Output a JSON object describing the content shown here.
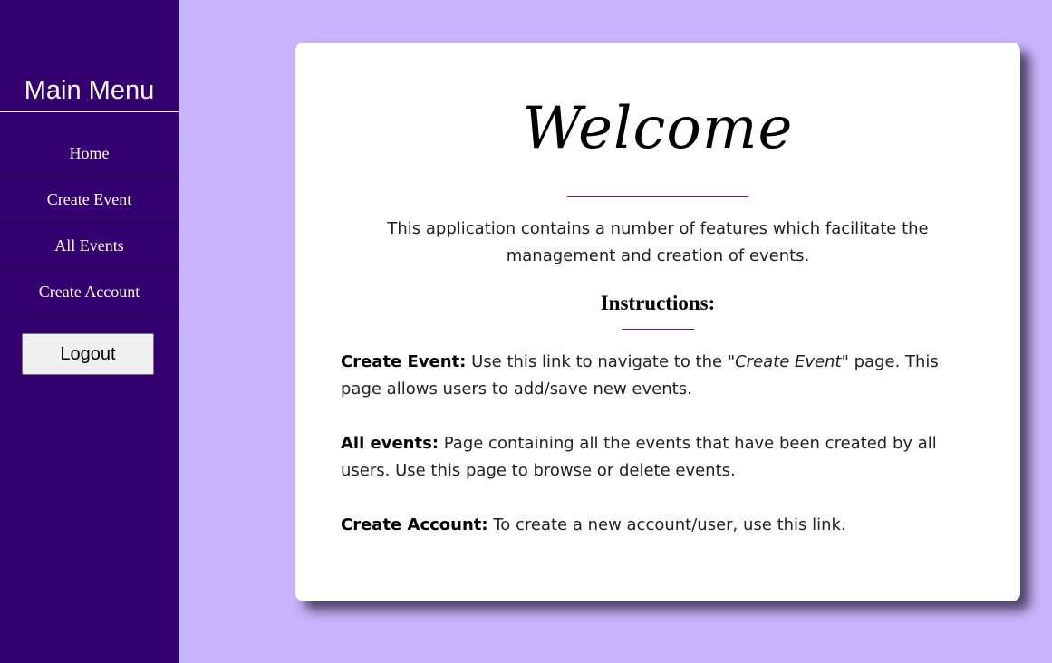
{
  "sidebar": {
    "title": "Main Menu",
    "items": [
      {
        "label": "Home"
      },
      {
        "label": "Create Event"
      },
      {
        "label": "All Events"
      },
      {
        "label": "Create Account"
      }
    ],
    "logout_label": "Logout"
  },
  "main": {
    "welcome": "Welcome",
    "intro": "This application contains a number of features which facilitate the management and creation of events.",
    "instructions_heading": "Instructions:",
    "instructions": [
      {
        "term": "Create Event:",
        "text_before": " Use this link to navigate to the ",
        "emphasis": "\"Create Event\"",
        "text_after": " page. This page allows users to add/save new events."
      },
      {
        "term": "All events:",
        "text": " Page containing all the events that have been created by all users. Use this page to browse or delete events."
      },
      {
        "term": "Create Account:",
        "text": " To create a new account/user, use this link."
      }
    ]
  },
  "colors": {
    "sidebar_bg": "#340070",
    "page_bg": "#c9b4fb",
    "card_bg": "#ffffff",
    "accent_rule": "#5b1a8a"
  }
}
